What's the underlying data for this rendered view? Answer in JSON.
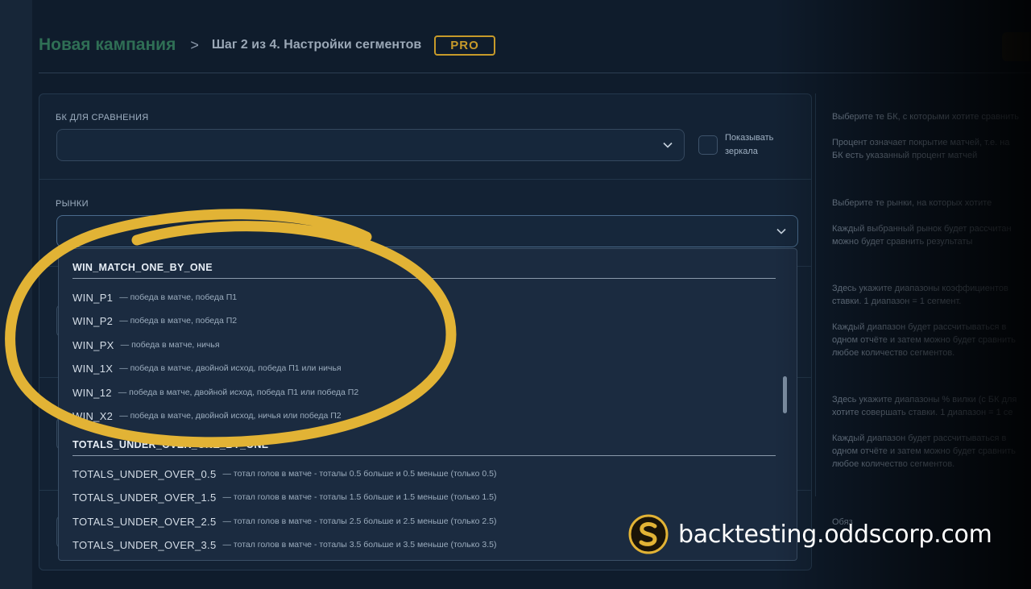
{
  "header": {
    "title": "Новая кампания",
    "separator": ">",
    "step": "Шаг 2 из 4. Настройки сегментов",
    "badge": "PRO"
  },
  "bookmakers": {
    "label": "БК ДЛЯ СРАВНЕНИЯ",
    "value": "",
    "mirrors_checkbox_line1": "Показывать",
    "mirrors_checkbox_line2": "зеркала",
    "mirrors_checked": false
  },
  "markets": {
    "label": "РЫНКИ",
    "value": ""
  },
  "dropdown": {
    "groups": [
      {
        "name": "WIN_MATCH_ONE_BY_ONE",
        "items": [
          {
            "code": "WIN_P1",
            "desc": "— победа в матче, победа П1"
          },
          {
            "code": "WIN_P2",
            "desc": "— победа в матче, победа П2"
          },
          {
            "code": "WIN_PX",
            "desc": "— победа в матче, ничья"
          },
          {
            "code": "WIN_1X",
            "desc": "— победа в матче, двойной исход, победа П1 или ничья"
          },
          {
            "code": "WIN_12",
            "desc": "— победа в матче, двойной исход, победа П1 или победа П2"
          },
          {
            "code": "WIN_X2",
            "desc": "— победа в матче, двойной исход, ничья или победа П2"
          }
        ]
      },
      {
        "name": "TOTALS_UNDER_OVER_ONE_BY_ONE",
        "items": [
          {
            "code": "TOTALS_UNDER_OVER_0.5",
            "desc": "— тотал голов в матче - тоталы 0.5 больше и 0.5 меньше (только 0.5)"
          },
          {
            "code": "TOTALS_UNDER_OVER_1.5",
            "desc": "— тотал голов в матче - тоталы 1.5 больше и 1.5 меньше (только 1.5)"
          },
          {
            "code": "TOTALS_UNDER_OVER_2.5",
            "desc": "— тотал голов в матче - тоталы 2.5 больше и 2.5 меньше (только 2.5)"
          },
          {
            "code": "TOTALS_UNDER_OVER_3.5",
            "desc": "— тотал голов в матче - тоталы 3.5 больше и 3.5 меньше (только 3.5)"
          }
        ]
      }
    ]
  },
  "help": {
    "bk_1": "Выберите те БК, с которыми хотите сравнить",
    "bk_2": "Процент означает покрытие матчей, т.е. на",
    "bk_3": "БК есть указанный процент матчей",
    "markets_1": "Выберите те рынки, на которых хотите",
    "markets_2": "Каждый выбранный рынок будет рассчитан",
    "markets_3": "можно будет сравнить результаты",
    "odds_1": "Здесь укажите диапазоны коэффициентов",
    "odds_2": "ставки. 1 диапазон = 1 сегмент.",
    "odds_3": "Каждый диапазон будет рассчитываться в",
    "odds_4": "одном отчёте и затем можно будет сравнить",
    "odds_5": "любое количество сегментов.",
    "fork_1": "Здесь укажите диапазоны % вилки (с БК для",
    "fork_2": "хотите совершать ставки. 1 диапазон = 1 се",
    "fork_3": "Каждый диапазон будет рассчитываться в",
    "fork_4": "одном отчёте и затем можно будет сравнить",
    "fork_5": "любое количество сегментов.",
    "bottom_1": "Обяз"
  },
  "brand": {
    "text": "backtesting.oddscorp.com"
  },
  "colors": {
    "accent_green": "#2f6f55",
    "pro_gold": "#c79a2a",
    "highlight_yellow": "#e2b335"
  }
}
